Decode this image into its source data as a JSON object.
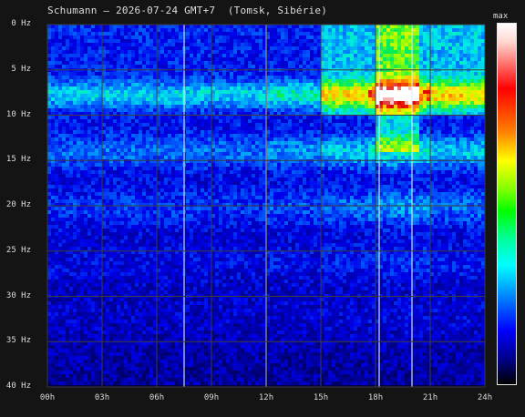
{
  "chart_data": {
    "type": "heatmap",
    "title": "Schumann — 2026-07-24 GMT+7  (Tomsk, Sibérie)",
    "x_ticks": [
      "00h",
      "03h",
      "06h",
      "09h",
      "12h",
      "15h",
      "18h",
      "21h",
      "24h"
    ],
    "y_ticks": [
      "0 Hz",
      "5 Hz",
      "10 Hz",
      "15 Hz",
      "20 Hz",
      "25 Hz",
      "30 Hz",
      "35 Hz",
      "40 Hz"
    ],
    "xlim": [
      0,
      24
    ],
    "ylim": [
      0,
      40
    ],
    "y_inverted": true,
    "grid": true,
    "colorbar": {
      "top_label": "max",
      "colors": [
        "#ffffff",
        "#ff0000",
        "#ffff00",
        "#00ff00",
        "#00ffff",
        "#0000ff",
        "#000000"
      ]
    },
    "resonance_bands_hz": [
      7.8,
      14.1,
      20.3,
      26.4,
      32.5
    ],
    "events": [
      {
        "hour": 7.5,
        "description": "vertical line"
      },
      {
        "hour": 12.0,
        "description": "vertical line"
      },
      {
        "hour": 18.2,
        "description": "vertical line"
      },
      {
        "hour": 20.0,
        "description": "vertical line"
      }
    ]
  }
}
